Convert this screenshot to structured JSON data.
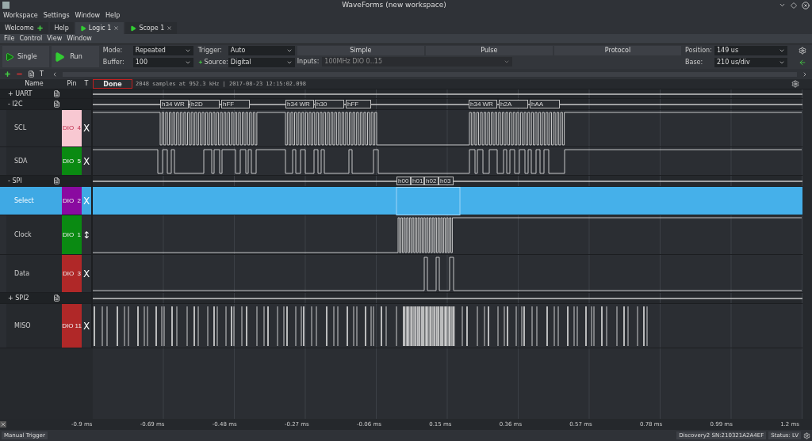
{
  "window": {
    "title": "WaveForms (new workspace)"
  },
  "menu": [
    "Workspace",
    "Settings",
    "Window",
    "Help"
  ],
  "tabs": [
    {
      "label": "Welcome",
      "kind": "add",
      "selected": false
    },
    {
      "label": "Help",
      "kind": "plain",
      "selected": false
    },
    {
      "label": "Logic 1",
      "kind": "instrument",
      "selected": true
    },
    {
      "label": "Scope 1",
      "kind": "instrument",
      "selected": false
    }
  ],
  "submenu": [
    "File",
    "Control",
    "View",
    "Window"
  ],
  "toolbar": {
    "single": "Single",
    "run": "Run",
    "mode": {
      "label": "Mode:",
      "value": "Repeated"
    },
    "buffer": {
      "label": "Buffer:",
      "value": "100"
    },
    "trigger": {
      "label": "Trigger:",
      "value": "Auto"
    },
    "source": {
      "label": "Source:",
      "value": "Digital"
    },
    "inputs": {
      "label": "Inputs:",
      "value": "100MHz DIO 0..15",
      "disabled": true
    },
    "trigger_tabs": [
      {
        "label": "Simple"
      },
      {
        "label": "Pulse"
      },
      {
        "label": "Protocol"
      }
    ],
    "position": {
      "label": "Position:",
      "value": "149 us"
    },
    "base": {
      "label": "Base:",
      "value": "210 us/div"
    }
  },
  "small_toolbar": {
    "items": [
      "T"
    ]
  },
  "header": {
    "name": "Name",
    "pin": "Pin",
    "t": "T",
    "status": "Done",
    "info": "2048 samples at 952.3 kHz | 2017-08-23 12:15:02.098"
  },
  "signals": [
    {
      "kind": "bus",
      "toggle": "+",
      "name": "UART"
    },
    {
      "kind": "bus",
      "toggle": "-",
      "name": "I2C",
      "decoded": [
        "h34 WR",
        "h2D",
        "hFF",
        "h34 WR",
        "h30",
        "hFF",
        "h34 WR",
        "h2A",
        "hAA"
      ],
      "children": [
        {
          "name": "SCL",
          "pin": "DIO  4",
          "color": "#f8c8d2",
          "trig": "X",
          "selected": false
        },
        {
          "name": "SDA",
          "pin": "DIO  5",
          "color": "#0a8a12",
          "trig": "X",
          "selected": false
        }
      ]
    },
    {
      "kind": "bus",
      "toggle": "-",
      "name": "SPI",
      "decoded": [
        "h00",
        "h01",
        "h02",
        "h03"
      ],
      "children": [
        {
          "name": "Select",
          "pin": "DIO  2",
          "color": "#8a0aa0",
          "trig": "X",
          "selected": true
        },
        {
          "name": "Clock",
          "pin": "DIO  1",
          "color": "#0a8a12",
          "trig": "↕",
          "selected": false
        },
        {
          "name": "Data",
          "pin": "DIO  3",
          "color": "#b02828",
          "trig": "X",
          "selected": false
        }
      ]
    },
    {
      "kind": "bus",
      "toggle": "+",
      "name": "SPI2"
    },
    {
      "kind": "channel",
      "name": "MISO",
      "pin": "DIO 11",
      "color": "#b02828",
      "trig": "X",
      "selected": false
    }
  ],
  "time_axis": [
    "-0.9 ms",
    "-0.69 ms",
    "-0.48 ms",
    "-0.27 ms",
    "-0.06 ms",
    "0.15 ms",
    "0.36 ms",
    "0.57 ms",
    "0.78 ms",
    "0.99 ms",
    "1.2 ms"
  ],
  "status_bar": {
    "trigger": "Manual Trigger",
    "device": "Discovery2 SN:210321A2A4EF",
    "status": "Status: LV"
  }
}
